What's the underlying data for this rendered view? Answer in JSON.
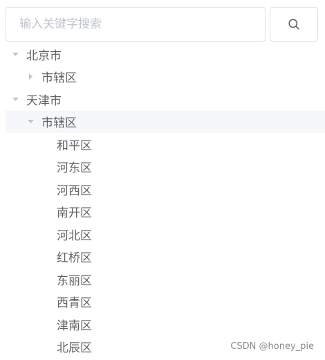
{
  "search": {
    "placeholder": "输入关键字搜索",
    "value": "",
    "button_icon": "search-icon"
  },
  "tree": {
    "beijing": {
      "label": "北京市",
      "expanded": true,
      "children": [
        {
          "label": "市辖区",
          "expanded": false
        }
      ]
    },
    "tianjin": {
      "label": "天津市",
      "expanded": true,
      "children": [
        {
          "label": "市辖区",
          "expanded": true,
          "current": true,
          "children": [
            {
              "label": "和平区"
            },
            {
              "label": "河东区"
            },
            {
              "label": "河西区"
            },
            {
              "label": "南开区"
            },
            {
              "label": "河北区"
            },
            {
              "label": "红桥区"
            },
            {
              "label": "东丽区"
            },
            {
              "label": "西青区"
            },
            {
              "label": "津南区"
            },
            {
              "label": "北辰区"
            }
          ]
        }
      ]
    }
  },
  "watermark": "CSDN @honey_pie",
  "colors": {
    "text": "#606266",
    "placeholder": "#c0c4cc",
    "border": "#dcdfe6",
    "caret": "#c0c4cc",
    "current_row_bg": "#f5f7fa"
  }
}
